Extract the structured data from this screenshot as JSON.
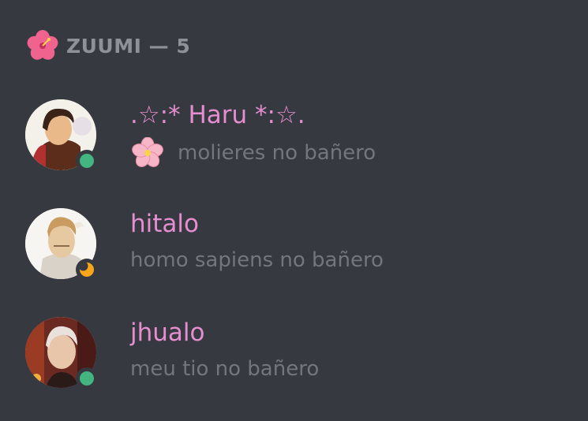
{
  "colors": {
    "background": "#36393f",
    "header_text": "#8e9297",
    "username": "#e58ed0",
    "status_text": "#72767d",
    "online": "#43b581",
    "idle": "#faa61a"
  },
  "category": {
    "icon": "hibiscus-icon",
    "label": "ZUUMI — 5"
  },
  "members": [
    {
      "name": ".☆:* Haru *:☆.",
      "status_emoji": "cherry-blossom-icon",
      "custom_status": "molieres no bañero",
      "presence": "online"
    },
    {
      "name": "hitalo",
      "status_emoji": "",
      "custom_status": "homo sapiens no bañero",
      "presence": "idle"
    },
    {
      "name": "jhualo",
      "status_emoji": "",
      "custom_status": "meu tio no bañero",
      "presence": "online"
    }
  ]
}
